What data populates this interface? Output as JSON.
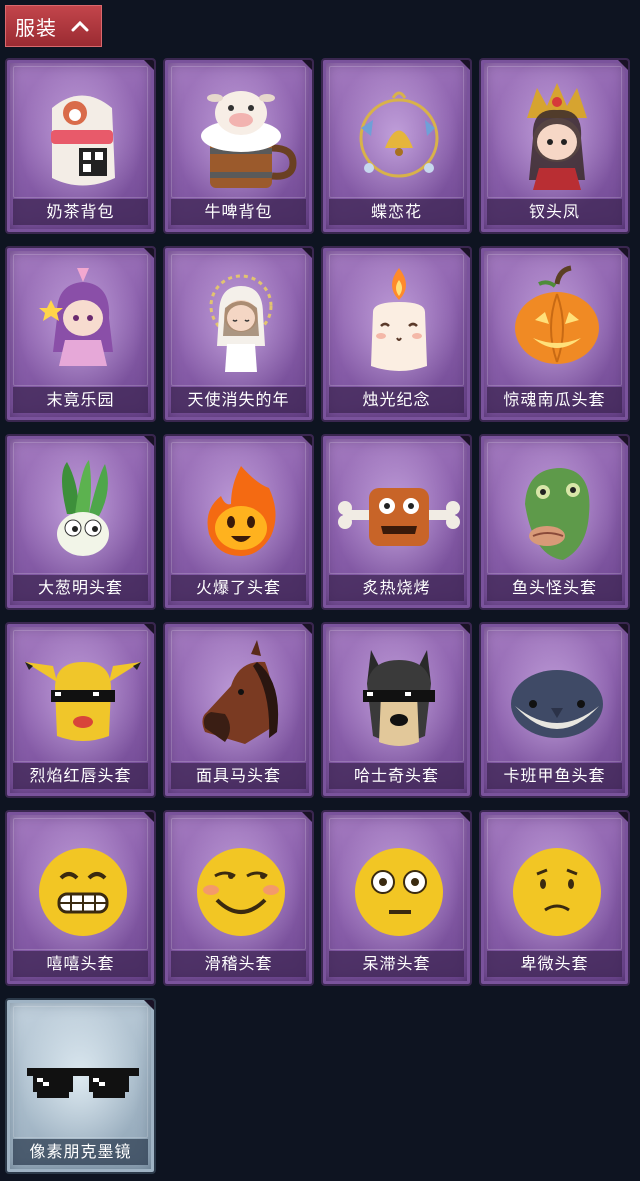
{
  "header": {
    "title": "服装",
    "toggle_icon": "chevron-up-icon"
  },
  "colors": {
    "header_bg": "#b53a41",
    "card_purple": "#8d62ae",
    "card_blue": "#a9bccb",
    "page_bg": "#0e1421"
  },
  "items": [
    {
      "label": "奶茶背包",
      "icon": "milk-tea-backpack-icon"
    },
    {
      "label": "牛啤背包",
      "icon": "cow-beer-backpack-icon"
    },
    {
      "label": "蝶恋花",
      "icon": "butterfly-bell-icon"
    },
    {
      "label": "钗头凤",
      "icon": "phoenix-crown-icon"
    },
    {
      "label": "末竟乐园",
      "icon": "dream-park-icon"
    },
    {
      "label": "天使消失的年",
      "icon": "angel-doll-icon"
    },
    {
      "label": "烛光纪念",
      "icon": "candle-icon"
    },
    {
      "label": "惊魂南瓜头套",
      "icon": "pumpkin-head-icon"
    },
    {
      "label": "大葱明头套",
      "icon": "scallion-head-icon"
    },
    {
      "label": "火爆了头套",
      "icon": "fire-head-icon"
    },
    {
      "label": "炙热烧烤",
      "icon": "roast-meat-icon"
    },
    {
      "label": "鱼头怪头套",
      "icon": "fish-head-icon"
    },
    {
      "label": "烈焰红唇头套",
      "icon": "yellow-mask-icon"
    },
    {
      "label": "面具马头套",
      "icon": "horse-head-icon"
    },
    {
      "label": "哈士奇头套",
      "icon": "husky-head-icon"
    },
    {
      "label": "卡班甲鱼头套",
      "icon": "fish-mask-icon"
    },
    {
      "label": "嘻嘻头套",
      "icon": "grin-emoji-icon"
    },
    {
      "label": "滑稽头套",
      "icon": "funny-emoji-icon"
    },
    {
      "label": "呆滞头套",
      "icon": "dazed-emoji-icon"
    },
    {
      "label": "卑微头套",
      "icon": "humble-emoji-icon"
    },
    {
      "label": "像素朋克墨镜",
      "icon": "pixel-sunglasses-icon"
    }
  ]
}
